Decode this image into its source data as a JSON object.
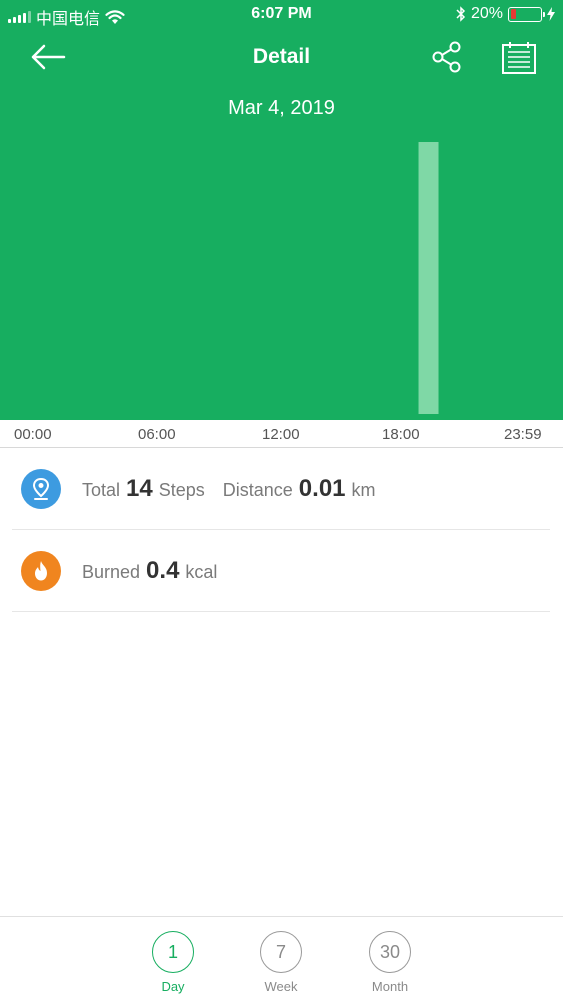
{
  "status_bar": {
    "carrier": "中国电信",
    "time": "6:07 PM",
    "battery": "20%"
  },
  "header": {
    "title": "Detail",
    "date": "Mar 4, 2019"
  },
  "chart_data": {
    "type": "bar",
    "x_ticks": [
      "00:00",
      "06:00",
      "12:00",
      "18:00",
      "23:59"
    ],
    "hours": [
      0,
      1,
      2,
      3,
      4,
      5,
      6,
      7,
      8,
      9,
      10,
      11,
      12,
      13,
      14,
      15,
      16,
      17,
      18,
      19,
      20,
      21,
      22,
      23
    ],
    "values": [
      0,
      0,
      0,
      0,
      0,
      0,
      0,
      0,
      0,
      0,
      0,
      0,
      0,
      0,
      0,
      0,
      0,
      14,
      0,
      0,
      0,
      0,
      0,
      0
    ],
    "bar_color": "#7fd8a6"
  },
  "stats": {
    "steps": {
      "total_label": "Total",
      "total_value": "14",
      "total_unit": "Steps",
      "distance_label": "Distance",
      "distance_value": "0.01",
      "distance_unit": "km",
      "icon": "location-pin-icon",
      "icon_color": "#3d9be0"
    },
    "burned": {
      "label": "Burned",
      "value": "0.4",
      "unit": "kcal",
      "icon": "flame-icon",
      "icon_color": "#f0851f"
    }
  },
  "tabs": [
    {
      "number": "1",
      "label": "Day",
      "active": true
    },
    {
      "number": "7",
      "label": "Week",
      "active": false
    },
    {
      "number": "30",
      "label": "Month",
      "active": false
    }
  ],
  "colors": {
    "accent": "#17ae60"
  }
}
